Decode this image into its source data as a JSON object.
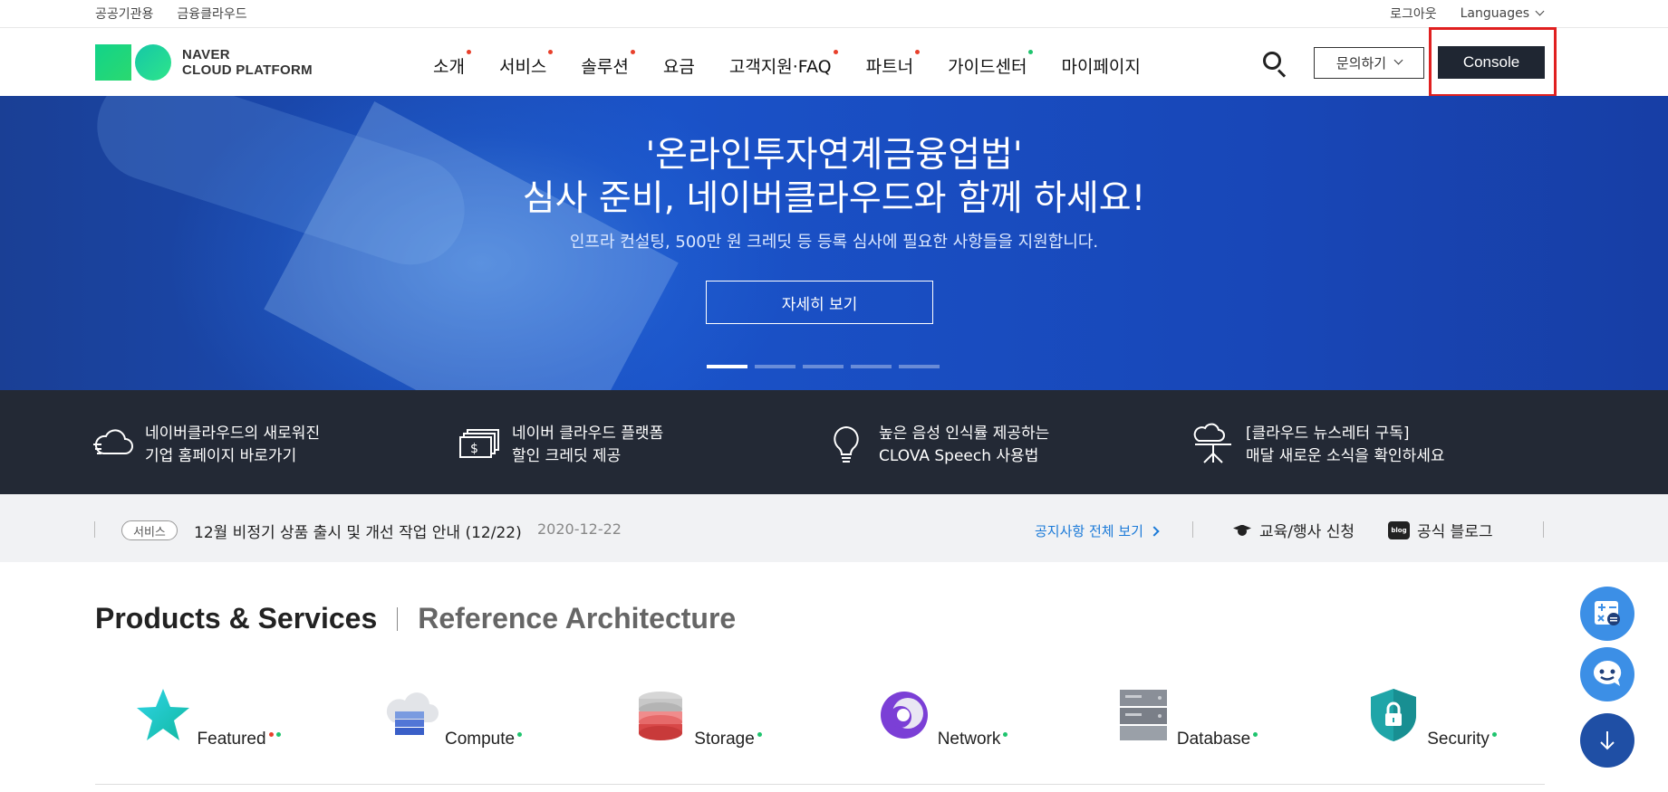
{
  "utility": {
    "left_links": [
      "공공기관용",
      "금융클라우드"
    ],
    "logout": "로그아웃",
    "languages": "Languages"
  },
  "header": {
    "logo_line1": "NAVER",
    "logo_line2": "CLOUD PLATFORM",
    "nav": [
      {
        "label": "소개",
        "dot": "#e8402b"
      },
      {
        "label": "서비스",
        "dot": "#e8402b"
      },
      {
        "label": "솔루션",
        "dot": "#e8402b"
      },
      {
        "label": "요금",
        "dot": ""
      },
      {
        "label": "고객지원·FAQ",
        "dot": "#e8402b"
      },
      {
        "label": "파트너",
        "dot": "#e8402b"
      },
      {
        "label": "가이드센터",
        "dot": "#1fc46e"
      },
      {
        "label": "마이페이지",
        "dot": ""
      }
    ],
    "inquiry_label": "문의하기",
    "console_label": "Console"
  },
  "hero": {
    "title_line1": "'온라인투자연계금융업법'",
    "title_line2": "심사 준비, 네이버클라우드와 함께 하세요!",
    "subtitle": "인프라 컨설팅, 500만 원 크레딧 등 등록 심사에 필요한 사항들을 지원합니다.",
    "cta": "자세히 보기",
    "slides": 5,
    "active_slide": 1
  },
  "strip": [
    {
      "line1": "네이버클라우드의 새로워진",
      "line2": "기업 홈페이지 바로가기",
      "icon": "cloud-speed-icon"
    },
    {
      "line1": "네이버 클라우드 플랫폼",
      "line2": "할인 크레딧 제공",
      "icon": "money-bills-icon"
    },
    {
      "line1": "높은 음성 인식률 제공하는",
      "line2": "CLOVA Speech 사용법",
      "icon": "lightbulb-icon"
    },
    {
      "line1": "[클라우드 뉴스레터 구독]",
      "line2": "매달 새로운 소식을 확인하세요",
      "icon": "presentation-cloud-icon"
    }
  ],
  "notice": {
    "tag": "서비스",
    "title": "12월 비정기 상품 출시 및 개선 작업 안내 (12/22)",
    "date": "2020-12-22",
    "view_all": "공지사항 전체 보기",
    "education": "교육/행사 신청",
    "blog": "공식 블로그",
    "blog_icon_text": "blog"
  },
  "section": {
    "active_tab": "Products & Services",
    "inactive_tab": "Reference Architecture"
  },
  "products": [
    {
      "label": "Featured",
      "dots": [
        "#e8402b",
        "#1fc46e"
      ],
      "icon": "star-icon"
    },
    {
      "label": "Compute",
      "dots": [
        "#1fc46e"
      ],
      "icon": "cloud-server-icon"
    },
    {
      "label": "Storage",
      "dots": [
        "#1fc46e"
      ],
      "icon": "storage-disk-icon"
    },
    {
      "label": "Network",
      "dots": [
        "#1fc46e"
      ],
      "icon": "network-ring-icon"
    },
    {
      "label": "Database",
      "dots": [
        "#1fc46e"
      ],
      "icon": "database-server-icon"
    },
    {
      "label": "Security",
      "dots": [
        "#1fc46e"
      ],
      "icon": "shield-lock-icon"
    }
  ],
  "colors": {
    "console_bg": "#1f2632",
    "highlight": "#e02020",
    "hero_blue": "#1a52c8",
    "strip_bg": "#232935",
    "link_blue": "#1b7ad8"
  }
}
